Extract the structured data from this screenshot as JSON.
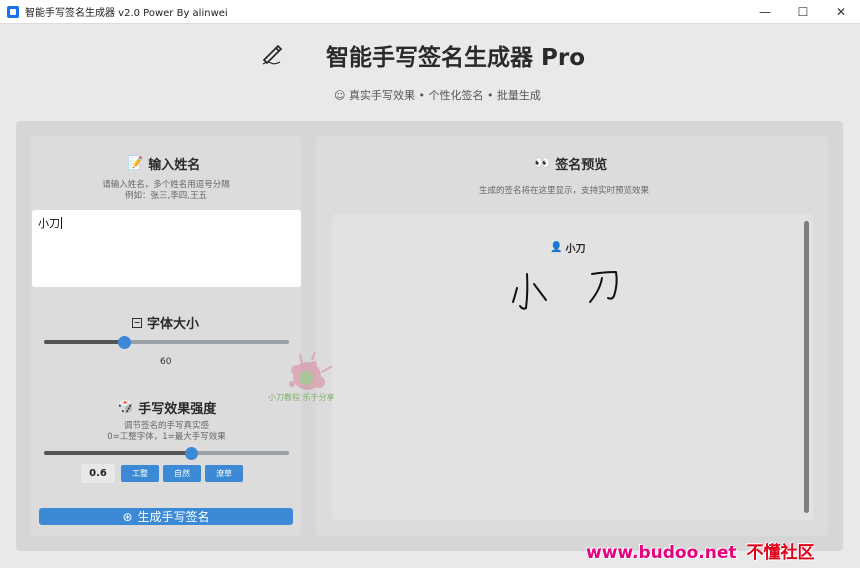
{
  "window": {
    "title": "智能手写签名生成器 v2.0 Power By alinwei",
    "minimize": "—",
    "maximize": "☐",
    "close": "✕"
  },
  "header": {
    "title": "智能手写签名生成器 Pro",
    "subtitle": "真实手写效果 • 个性化签名 • 批量生成",
    "icon": "signature-pen-icon"
  },
  "input_section": {
    "title": "输入姓名",
    "hint_line1": "请输入姓名，多个姓名用逗号分隔",
    "hint_line2": "例如：张三,李四,王五",
    "value": "小刀"
  },
  "font_size": {
    "title": "字体大小",
    "value": "60",
    "fraction": 0.33
  },
  "handwriting": {
    "title": "手写效果强度",
    "hint_line1": "调节签名的手写真实感",
    "hint_line2": "0=工整字体，1=最大手写效果",
    "value": "0.6",
    "fraction": 0.6,
    "presets": [
      "工整",
      "自然",
      "潦草"
    ]
  },
  "generate_button": "生成手写签名",
  "preview": {
    "title": "签名预览",
    "hint": "生成的签名将在这里显示，支持实时预览效果",
    "sig_label": "小刀"
  },
  "watermark": {
    "text": "小刀教程 乐于分享"
  },
  "badge": {
    "url": "www.budoo.net",
    "name": "不懂社区"
  },
  "colors": {
    "accent": "#3c8ad6",
    "badge_pink": "#e6007e",
    "badge_red": "#e1001a"
  }
}
